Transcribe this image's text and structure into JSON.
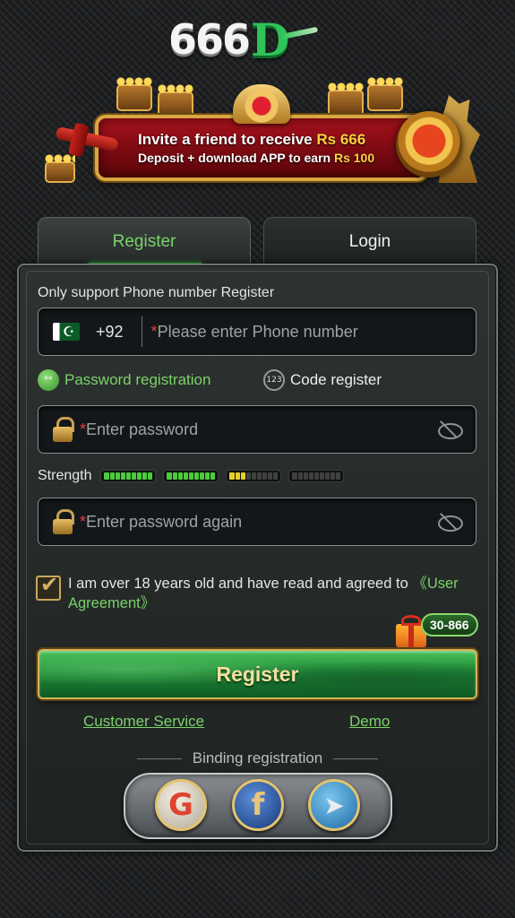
{
  "logo": {
    "digits": "666",
    "letter": "D"
  },
  "banner": {
    "line1_prefix": "Invite a friend to receive ",
    "line1_amount": "Rs 666",
    "line2_prefix": "Deposit + download APP to earn ",
    "line2_amount": "Rs 100"
  },
  "tabs": [
    {
      "label": "Register",
      "active": true
    },
    {
      "label": "Login",
      "active": false
    }
  ],
  "form": {
    "hint": "Only support Phone number Register",
    "country_code": "+92",
    "phone_placeholder": "Please enter Phone number",
    "required_mark": "*",
    "modes": {
      "password": "Password registration",
      "code": "Code register"
    },
    "password_placeholder": "Enter password",
    "password_again_placeholder": "Enter password again",
    "strength_label": "Strength",
    "agreement_text": "I am over 18 years old and have read and agreed to ",
    "agreement_link": "《User Agreement》",
    "promo_badge": "30-866",
    "register_button": "Register"
  },
  "links": {
    "customer_service": "Customer Service",
    "demo": "Demo"
  },
  "binding": {
    "label": "Binding registration"
  },
  "icons": {
    "flag": "pakistan-flag-icon",
    "lock": "lock-icon",
    "eye": "eye-off-icon",
    "gift": "gift-icon",
    "google": "G",
    "facebook": "f",
    "telegram": "➤"
  },
  "colors": {
    "accent_green": "#7bd26a",
    "required_red": "#e2403b",
    "gold": "#ffd23e"
  }
}
